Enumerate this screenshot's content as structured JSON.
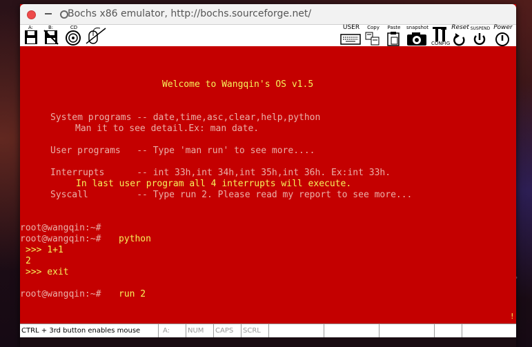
{
  "window": {
    "title": "Bochs x86 emulator, http://bochs.sourceforge.net/"
  },
  "toolbar": {
    "floppy_a": "A:",
    "floppy_b": "B:",
    "cdrom": "CD",
    "user": "USER",
    "copy": "Copy",
    "paste": "Paste",
    "snapshot": "snapshot",
    "config": "CONFIG",
    "reset": "Reset",
    "suspend": "SUSPEND",
    "power": "Power"
  },
  "screen": {
    "welcome": "Welcome to Wangqin's OS v1.5",
    "sys_line": "System programs -- date,time,asc,clear,help,python",
    "sys_detail": "Man it to see detail.Ex: man date.",
    "user_line": "User programs   -- Type 'man run' to see more....",
    "int_line": "Interrupts      -- int 33h,int 34h,int 35h,int 36h. Ex:int 33h.",
    "int_detail": "In last user program all 4 interrupts will execute.",
    "syscall_line": "Syscall         -- Type run 2. Please read my report to see more...",
    "prompt": "root@wangqin:~#",
    "cmd_python": "python",
    "py_prompt1": ">>> 1+1",
    "py_result": "2",
    "py_prompt2": ">>> exit",
    "cmd_run": "run 2",
    "cursor": "!"
  },
  "statusbar": {
    "mouse_hint": "CTRL + 3rd button enables mouse",
    "drive": "A:",
    "num": "NUM",
    "caps": "CAPS",
    "scrl": "SCRL"
  },
  "colors": {
    "screen_bg": "#c40000",
    "prompt_text": "#eab0a8",
    "highlight_text": "#f6f25a"
  }
}
